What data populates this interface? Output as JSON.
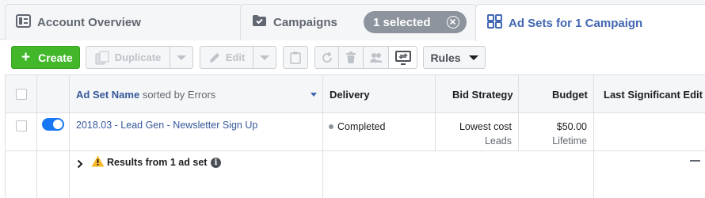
{
  "tabs": {
    "account_overview": "Account Overview",
    "campaigns": "Campaigns",
    "selected_count": "1 selected",
    "ad_sets": "Ad Sets for 1 Campaign"
  },
  "toolbar": {
    "create_label": "Create",
    "duplicate_label": "Duplicate",
    "edit_label": "Edit",
    "rules_label": "Rules"
  },
  "table": {
    "headers": {
      "name": "Ad Set Name",
      "name_sort": "sorted by Errors",
      "delivery": "Delivery",
      "bid_strategy": "Bid Strategy",
      "budget": "Budget",
      "last_edit": "Last Significant Edit"
    },
    "rows": [
      {
        "name": "2018.03 - Lead Gen - Newsletter Sign Up",
        "delivery": "Completed",
        "bid_strategy": "Lowest cost",
        "bid_strategy_sub": "Leads",
        "budget": "$50.00",
        "budget_sub": "Lifetime",
        "enabled": true
      }
    ],
    "summary": "Results from 1 ad set"
  },
  "colors": {
    "accent": "#4267b2",
    "create_green": "#42b72a",
    "toggle_blue": "#1877f2",
    "warning": "#f7b928"
  }
}
